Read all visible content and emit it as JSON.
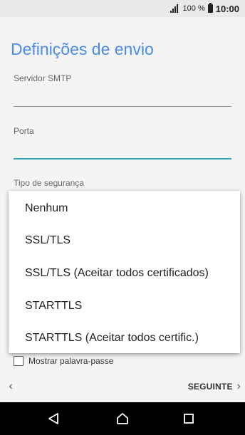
{
  "status_bar": {
    "battery": "100 %",
    "time": "10:00"
  },
  "page": {
    "title": "Definições de envio"
  },
  "fields": {
    "smtp_server_label": "Servidor SMTP",
    "port_label": "Porta",
    "security_label": "Tipo de segurança"
  },
  "dropdown": {
    "options": [
      "Nenhum",
      "SSL/TLS",
      "SSL/TLS (Aceitar todos certificados)",
      "STARTTLS",
      "STARTTLS (Aceitar todos certific.)"
    ]
  },
  "checkbox": {
    "label": "Mostrar palavra-passe"
  },
  "footer": {
    "back_glyph": "‹",
    "next_label": "SEGUINTE",
    "next_glyph": "›"
  }
}
